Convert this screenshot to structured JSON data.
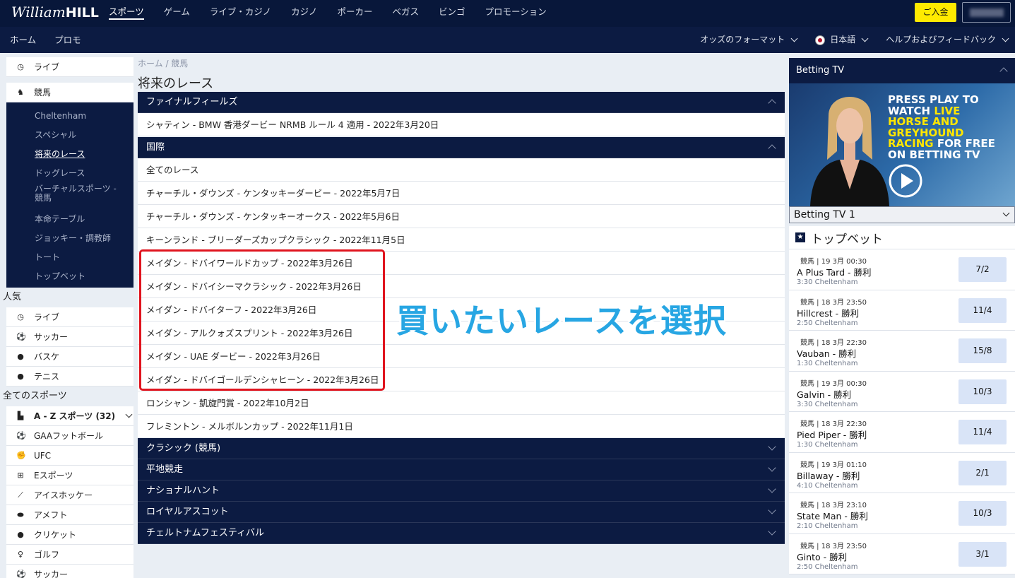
{
  "brand": {
    "logo_script": "William",
    "logo_bold": "HILL"
  },
  "topnav": [
    "スポーツ",
    "ゲーム",
    "ライブ・カジノ",
    "カジノ",
    "ポーカー",
    "ベガス",
    "ビンゴ",
    "プロモーション"
  ],
  "deposit_label": "ご入金",
  "subnav": [
    "ホーム",
    "プロモ"
  ],
  "subright": {
    "odds_format": "オッズのフォーマット",
    "language": "日本語",
    "help": "ヘルプおよびフィードバック"
  },
  "sidebar": {
    "top": [
      {
        "label": "ライブ",
        "icon": "◷"
      },
      {
        "label": "競馬",
        "icon": "♞"
      }
    ],
    "racing_sub": [
      "Cheltenham",
      "スペシャル",
      "将来のレース",
      "ドッグレース",
      "バーチャルスポーツ - 競馬",
      "本命テーブル",
      "ジョッキー・調教師",
      "トート",
      "トップベット"
    ],
    "popular_heading": "人気",
    "popular": [
      {
        "label": "ライブ",
        "icon": "◷"
      },
      {
        "label": "サッカー",
        "icon": "⚽"
      },
      {
        "label": "バスケ",
        "icon": "●"
      },
      {
        "label": "テニス",
        "icon": "●"
      }
    ],
    "all_sports_heading": "全てのスポーツ",
    "az_label": "A - Z スポーツ (32)",
    "az_icon": "▙",
    "sports": [
      {
        "label": "GAAフットボール",
        "icon": "⚽"
      },
      {
        "label": "UFC",
        "icon": "✊"
      },
      {
        "label": "Eスポーツ",
        "icon": "⊞"
      },
      {
        "label": "アイスホッケー",
        "icon": "⟋"
      },
      {
        "label": "アメフト",
        "icon": "⬬"
      },
      {
        "label": "クリケット",
        "icon": "●"
      },
      {
        "label": "ゴルフ",
        "icon": "♀"
      },
      {
        "label": "サッカー",
        "icon": "⚽"
      }
    ]
  },
  "breadcrumb": "ホーム  /  競馬",
  "page_title": "将来のレース",
  "sections": {
    "final_fields": {
      "title": "ファイナルフィールズ",
      "rows": [
        "シャティン - BMW 香港ダービー NRMB ルール 4 適用 - 2022年3月20日"
      ]
    },
    "international": {
      "title": "国際",
      "rows": [
        "全てのレース",
        "チャーチル・ダウンズ - ケンタッキーダービー - 2022年5月7日",
        "チャーチル・ダウンズ - ケンタッキーオークス - 2022年5月6日",
        "キーンランド - ブリーダーズカップクラシック - 2022年11月5日",
        "メイダン - ドバイワールドカップ - 2022年3月26日",
        "メイダン - ドバイシーマクラシック - 2022年3月26日",
        "メイダン - ドバイターフ - 2022年3月26日",
        "メイダン - アルクォズスプリント - 2022年3月26日",
        "メイダン - UAE ダービー - 2022年3月26日",
        "メイダン - ドバイゴールデンシャヒーン - 2022年3月26日",
        "ロンシャン - 凱旋門賞 - 2022年10月2日",
        "フレミントン - メルボルンカップ - 2022年11月1日"
      ]
    },
    "collapsed": [
      "クラシック (競馬)",
      "平地競走",
      "ナショナルハント",
      "ロイヤルアスコット",
      "チェルトナムフェスティバル"
    ]
  },
  "overlay_text": "買いたいレースを選択",
  "betting_tv": {
    "title": "Betting TV",
    "promo_lines": [
      "PRESS PLAY TO",
      "WATCH LIVE",
      "HORSE AND",
      "GREYHOUND",
      "RACING FOR FREE",
      "ON BETTING TV"
    ],
    "channel": "Betting TV 1",
    "promo_white": "#ffffff",
    "promo_yellow": "#ffe600"
  },
  "top_bets": {
    "title": "トップベット",
    "items": [
      {
        "meta": "競馬 | 19 3月 00:30",
        "selection": "A Plus Tard - 勝利",
        "event": "3:30 Cheltenham",
        "odds": "7/2"
      },
      {
        "meta": "競馬 | 18 3月 23:50",
        "selection": "Hillcrest - 勝利",
        "event": "2:50 Cheltenham",
        "odds": "11/4"
      },
      {
        "meta": "競馬 | 18 3月 22:30",
        "selection": "Vauban - 勝利",
        "event": "1:30 Cheltenham",
        "odds": "15/8"
      },
      {
        "meta": "競馬 | 19 3月 00:30",
        "selection": "Galvin - 勝利",
        "event": "3:30 Cheltenham",
        "odds": "10/3"
      },
      {
        "meta": "競馬 | 18 3月 22:30",
        "selection": "Pied Piper - 勝利",
        "event": "1:30 Cheltenham",
        "odds": "11/4"
      },
      {
        "meta": "競馬 | 19 3月 01:10",
        "selection": "Billaway - 勝利",
        "event": "4:10 Cheltenham",
        "odds": "2/1"
      },
      {
        "meta": "競馬 | 18 3月 23:10",
        "selection": "State Man - 勝利",
        "event": "2:10 Cheltenham",
        "odds": "10/3"
      },
      {
        "meta": "競馬 | 18 3月 23:50",
        "selection": "Ginto - 勝利",
        "event": "2:50 Cheltenham",
        "odds": "3/1"
      }
    ]
  }
}
